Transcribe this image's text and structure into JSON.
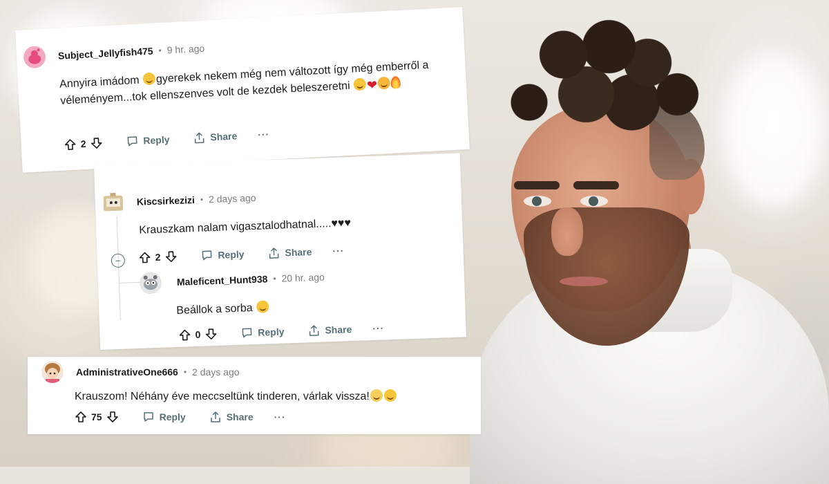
{
  "colors": {
    "card_bg": "#ffffff",
    "meta_gray": "#7c7c7c",
    "action_gray": "#576f76",
    "text": "#1c1c1c"
  },
  "comments": [
    {
      "username": "Subject_Jellyfish475",
      "time": "9 hr. ago",
      "text_line1": "Annyira imádom",
      "text_line1b": "gyerekek nekem még nem változott így még emberről a",
      "text_line2": "véleményem...tok ellenszenves volt de kezdek beleszeretni",
      "votes": "2",
      "reply_label": "Reply",
      "share_label": "Share",
      "more_label": "···",
      "avatar_icon": "reddit-snoo-avatar-pink"
    },
    {
      "username": "Kiscsirkezizi",
      "time": "2 days ago",
      "text": "Krauszkam nalam vigasztalodhatnal.....♥♥♥",
      "votes": "2",
      "reply_label": "Reply",
      "share_label": "Share",
      "more_label": "···",
      "collapse_label": "−",
      "avatar_icon": "reddit-snoo-avatar-box"
    },
    {
      "username": "Maleficent_Hunt938",
      "time": "20 hr. ago",
      "text": "Beállok a sorba",
      "votes": "0",
      "reply_label": "Reply",
      "share_label": "Share",
      "more_label": "···",
      "avatar_icon": "reddit-snoo-avatar-gray"
    },
    {
      "username": "AdministrativeOne666",
      "time": "2 days ago",
      "text": "Krauszom! Néhány éve meccseltünk tinderen, várlak vissza!",
      "votes": "75",
      "reply_label": "Reply",
      "share_label": "Share",
      "more_label": "···",
      "avatar_icon": "reddit-snoo-avatar-girl"
    }
  ],
  "separator": "•"
}
